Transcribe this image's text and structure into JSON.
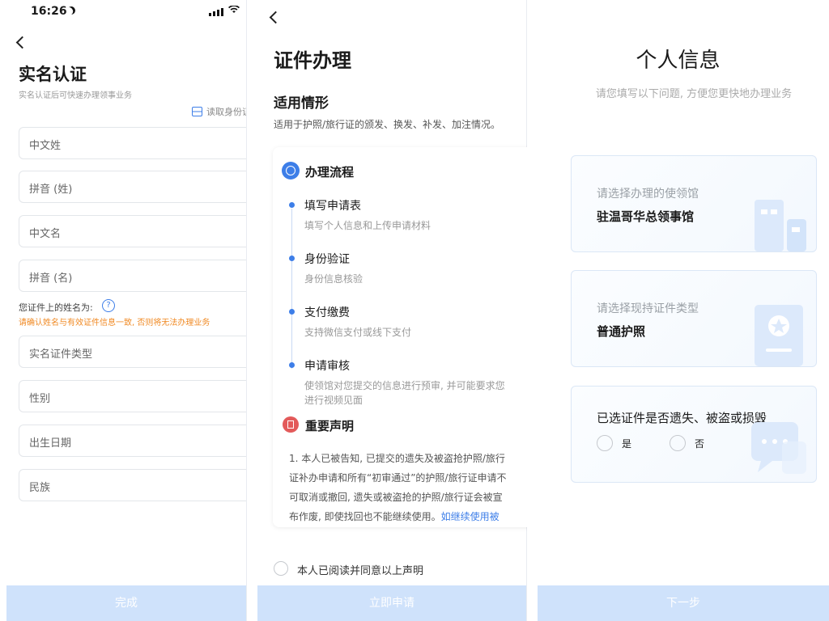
{
  "status_bar": {
    "time": "16:26"
  },
  "panel1": {
    "title": "实名认证",
    "subtitle": "实名认证后可快速办理领事业务",
    "scan_link": "读取身份证",
    "fields": [
      "中文姓",
      "拼音 (姓)",
      "中文名",
      "拼音 (名)"
    ],
    "name_hint": "您证件上的姓名为:",
    "warning": "请确认姓名与有效证件信息一致, 否则将无法办理业务",
    "fields2": [
      "实名证件类型",
      "性别",
      "出生日期",
      "民族"
    ],
    "submit": "完成",
    "colors": {
      "warning": "#f08a24",
      "accent": "#3d7ee8",
      "button": "#cfe2fb"
    }
  },
  "panel2": {
    "title": "证件办理",
    "section_title": "适用情形",
    "section_desc": "适用于护照/旅行证的颁发、换发、补发、加注情况。",
    "process_title": "办理流程",
    "steps": [
      {
        "title": "填写申请表",
        "desc": "填写个人信息和上传申请材料"
      },
      {
        "title": "身份验证",
        "desc": "身份信息核验"
      },
      {
        "title": "支付缴费",
        "desc": "支持微信支付或线下支付"
      },
      {
        "title": "申请审核",
        "desc": "使领馆对您提交的信息进行预审, 并可能要求您",
        "desc2": "进行视频见面"
      }
    ],
    "notice_title": "重要声明",
    "notice_lines": [
      "1. 本人已被告知, 已提交的遗失及被盗抢护照/旅行",
      "证补办申请和所有“初审通过”的护照/旅行证申请不",
      "可取消或撤回, 遗失或被盗抢的护照/旅行证会被宣",
      "布作废, 即使找回也不能继续使用。"
    ],
    "notice_link": "如继续使用被",
    "agree": "本人已阅读并同意以上声明",
    "submit": "立即申请"
  },
  "panel3": {
    "title": "个人信息",
    "subtitle": "请您填写以下问题, 方便您更快地办理业务",
    "box1_label": "请选择办理的使领馆",
    "box1_value": "驻温哥华总领事馆",
    "box2_label": "请选择现持证件类型",
    "box2_value": "普通护照",
    "box3_question": "已选证件是否遗失、被盗或损毁",
    "yes": "是",
    "no": "否",
    "next": "下一步"
  }
}
